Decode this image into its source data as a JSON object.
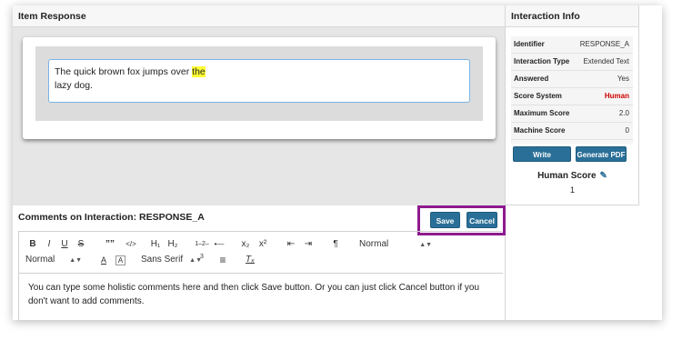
{
  "item_response": {
    "title": "Item Response",
    "text_line1": "The quick brown fox jumps over ",
    "text_highlight": "the",
    "text_line2": "lazy dog."
  },
  "comments": {
    "title": "Comments on Interaction: RESPONSE_A",
    "save_label": "Save",
    "cancel_label": "Cancel",
    "toolbar": {
      "bold": "B",
      "italic": "I",
      "underline": "U",
      "strike": "S",
      "quote": "””",
      "code": "</>",
      "h1": "H₁",
      "h2": "H₂",
      "ordered_list": "1–2–3",
      "bullet_list": "•—",
      "subscript": "x₂",
      "superscript": "x²",
      "outdent": "⇤",
      "indent": "⇥",
      "rtl": "¶",
      "size_select": "Normal",
      "heading_select": "Normal",
      "color": "A",
      "background": "A",
      "font_select": "Sans Serif",
      "align": "≡",
      "clean": "Tₓ"
    },
    "body_text": "You can type some holistic comments here and then click Save button. Or you can just click Cancel button if you don't want to add comments."
  },
  "interaction_info": {
    "title": "Interaction Info",
    "rows": [
      {
        "label": "Identifier",
        "value": "RESPONSE_A"
      },
      {
        "label": "Interaction Type",
        "value": "Extended Text"
      },
      {
        "label": "Answered",
        "value": "Yes"
      },
      {
        "label": "Score System",
        "value": "Human"
      },
      {
        "label": "Maximum Score",
        "value": "2.0"
      },
      {
        "label": "Machine Score",
        "value": "0"
      }
    ],
    "write_comments_label": "Write Comments",
    "generate_pdf_label": "Generate PDF",
    "human_score_label": "Human Score",
    "human_score_value": "1"
  },
  "colors": {
    "accent_button": "#2a6f97",
    "highlight": "#ffff33",
    "human_text": "#cc0000",
    "focus_box": "#8e1a8e"
  },
  "icons": [
    "pencil-icon"
  ]
}
